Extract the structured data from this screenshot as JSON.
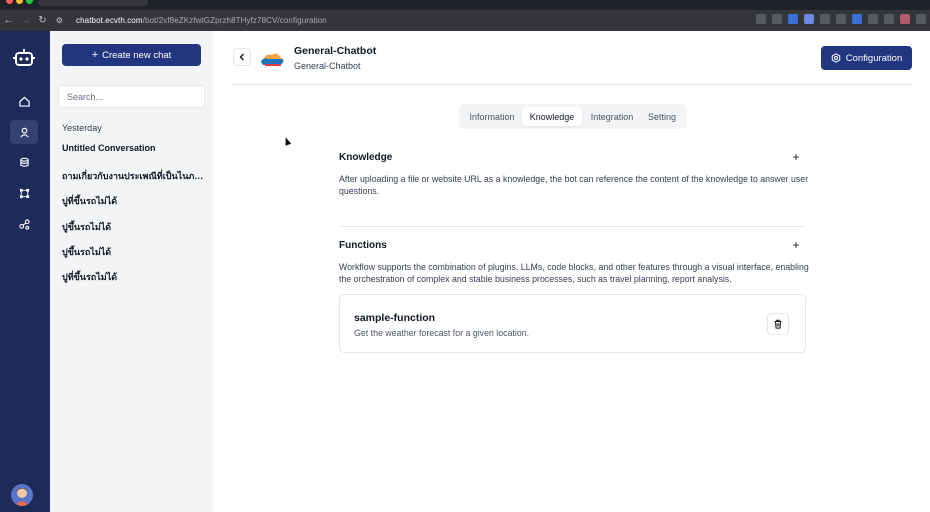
{
  "browser": {
    "url_host": "chatbot.ecvth.com",
    "url_path": "/bot/2xf8eZKzfwtGZprzh8THyfz78CV/configuration"
  },
  "sidebar": {
    "new_chat_label": "Create new chat",
    "search_placeholder": "Search...",
    "group_label": "Yesterday",
    "chats": [
      "Untitled Conversation",
      "ถามเกี่ยวกับงานประเพณีที่เป็นไนภาคเ...",
      "ปูที่ขึ้นรถไม่ได้",
      "ปูขึ้นรถไม่ได้",
      "ปูขึ้นรถไม่ได้",
      "ปูที่ขึ้นรถไม่ได้"
    ]
  },
  "header": {
    "title": "General-Chatbot",
    "subtitle": "General-Chatbot",
    "config_label": "Configuration"
  },
  "tabs": [
    "Information",
    "Knowledge",
    "Integration",
    "Setting"
  ],
  "active_tab": "Knowledge",
  "knowledge": {
    "title": "Knowledge",
    "description": "After uploading a file or website URL as a knowledge, the bot can reference the content of the knowledge to answer user questions."
  },
  "functions": {
    "title": "Functions",
    "description": "Workflow supports the combination of plugins, LLMs, code blocks, and other features through a visual interface, enabling the orchestration of complex and stable business processes, such as travel planning, report analysis.",
    "items": [
      {
        "name": "sample-function",
        "description": "Get the weather forecast for a given location."
      }
    ]
  },
  "colors": {
    "rail": "#1e2a5a",
    "primary": "#22357f",
    "sidebar_bg": "#f3f4f6"
  },
  "icons": {
    "rail": [
      "bot-logo-icon",
      "home-icon",
      "bot-icon",
      "database-icon",
      "workflow-icon",
      "share-icon"
    ]
  }
}
